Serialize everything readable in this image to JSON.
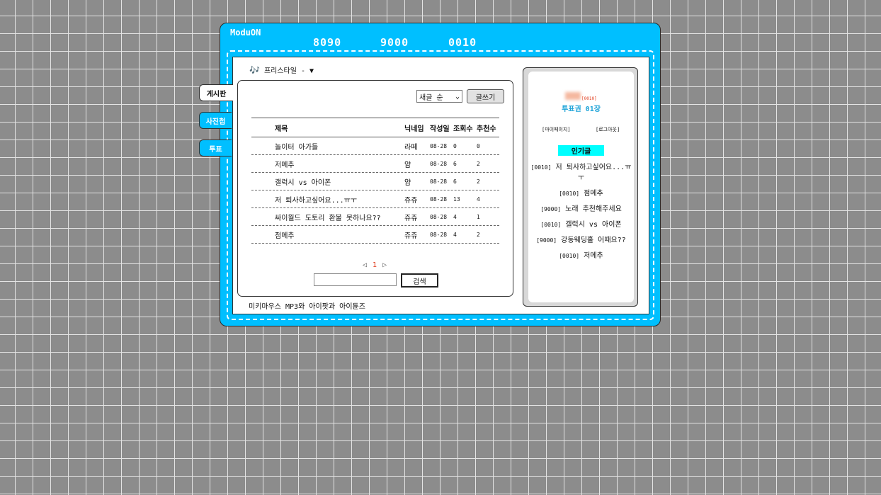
{
  "header": {
    "brand": "ModuON",
    "codes": [
      "8090",
      "9000",
      "0010"
    ]
  },
  "tabs": [
    {
      "label": "게시판"
    },
    {
      "label": "사진첩"
    },
    {
      "label": "투표"
    }
  ],
  "breadcrumb": {
    "icon": "music-note-icon",
    "text": "프리스타일 - ▼"
  },
  "board": {
    "sort_selected": "새글 순",
    "write_label": "글쓰기",
    "columns": {
      "title": "제목",
      "nick": "닉네임",
      "date": "작성일",
      "views": "조회수",
      "recommend": "추천수"
    },
    "rows": [
      {
        "title": "놀이터 아가들",
        "nick": "라떼",
        "date": "08-28",
        "views": "0",
        "recommend": "0"
      },
      {
        "title": "저메추",
        "nick": "얌",
        "date": "08-28",
        "views": "6",
        "recommend": "2"
      },
      {
        "title": "갤럭시 vs 아이폰",
        "nick": "얌",
        "date": "08-28",
        "views": "6",
        "recommend": "2"
      },
      {
        "title": "저 퇴사하고싶어요...ㅠㅜ",
        "nick": "쥬쥬",
        "date": "08-28",
        "views": "13",
        "recommend": "4"
      },
      {
        "title": "싸이월드 도토리 환불 못하나요??",
        "nick": "쥬쥬",
        "date": "08-28",
        "views": "4",
        "recommend": "1"
      },
      {
        "title": "점메추",
        "nick": "쥬쥬",
        "date": "08-28",
        "views": "4",
        "recommend": "2"
      }
    ],
    "pager": {
      "prev": "◁",
      "current": "1",
      "next": "▷"
    },
    "search_value": "",
    "search_label": "검색"
  },
  "footer_text": "미키마우스 MP3와 아이팟과 아이튠즈",
  "sidebar": {
    "user_code": "[0010]",
    "ticket": "투표권 01장",
    "mypage": "[마이페이지]",
    "logout": "[로그아웃]",
    "popular_title": "인기글",
    "popular": [
      {
        "code": "[0010]",
        "title": "저 퇴사하고싶어요...ㅠㅜ"
      },
      {
        "code": "[0010]",
        "title": "점메추"
      },
      {
        "code": "[9000]",
        "title": "노래 추천해주세요"
      },
      {
        "code": "[0010]",
        "title": "갤럭시 vs 아이폰"
      },
      {
        "code": "[9000]",
        "title": "강동웨딩홀 어때요??"
      },
      {
        "code": "[0010]",
        "title": "저메추"
      }
    ]
  },
  "colors": {
    "accent": "#00bfff",
    "highlight": "#00ffff",
    "page_number": "#e03a1a"
  }
}
